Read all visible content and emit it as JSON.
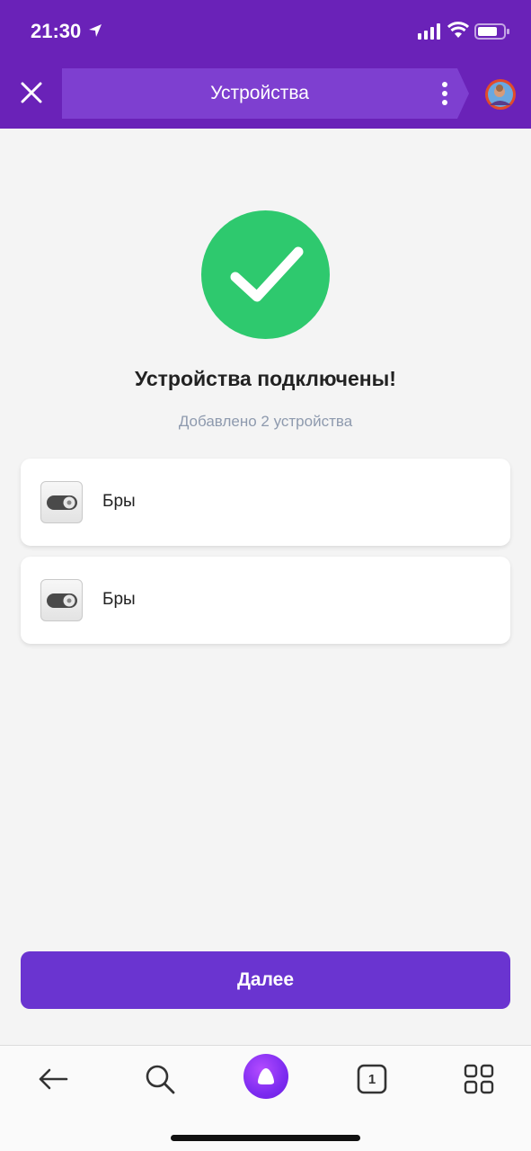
{
  "status_bar": {
    "time": "21:30",
    "icons": [
      "location-arrow-icon",
      "signal-icon",
      "wifi-icon",
      "battery-icon"
    ]
  },
  "header": {
    "title": "Устройства",
    "close_icon": "close-icon",
    "menu_icon": "more-vertical-icon",
    "avatar": "user-avatar"
  },
  "main": {
    "heading": "Устройства подключены!",
    "subheading": "Добавлено 2 устройства",
    "devices": [
      {
        "name": "Бры",
        "icon": "switch-icon"
      },
      {
        "name": "Бры",
        "icon": "switch-icon"
      }
    ],
    "next_button": "Далее"
  },
  "bottom_nav": {
    "items": [
      "back-arrow-icon",
      "search-icon",
      "alice-icon",
      "tabs-icon",
      "apps-grid-icon"
    ],
    "tabs_count": "1"
  },
  "colors": {
    "header_bg": "#6a22b8",
    "urlbar_bg": "#7e3fd0",
    "success_green": "#2ec96e",
    "primary_button": "#6a34d0",
    "page_bg": "#f4f4f4"
  }
}
